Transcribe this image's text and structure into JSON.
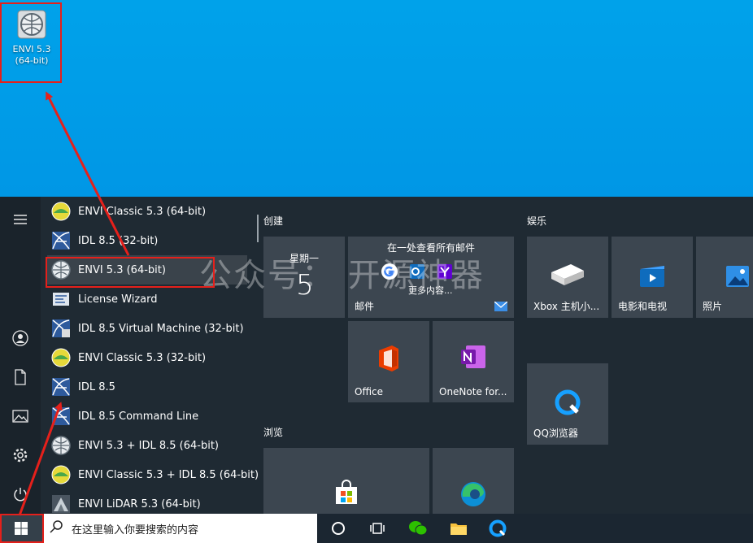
{
  "desktop": {
    "icon_label": "ENVI 5.3\n(64-bit)"
  },
  "apps": [
    {
      "label": "ENVI Classic 5.3 (64-bit)",
      "icon": "envi-classic-icon"
    },
    {
      "label": "IDL 8.5 (32-bit)",
      "icon": "idl-icon"
    },
    {
      "label": "ENVI 5.3 (64-bit)",
      "icon": "envi-icon"
    },
    {
      "label": "License Wizard",
      "icon": "license-wizard-icon"
    },
    {
      "label": "IDL 8.5 Virtual Machine (32-bit)",
      "icon": "idl-vm-icon"
    },
    {
      "label": "ENVI Classic 5.3 (32-bit)",
      "icon": "envi-classic-icon"
    },
    {
      "label": "IDL 8.5",
      "icon": "idl-icon"
    },
    {
      "label": "IDL 8.5 Command Line",
      "icon": "idl-icon"
    },
    {
      "label": "ENVI 5.3 + IDL 8.5 (64-bit)",
      "icon": "envi-icon"
    },
    {
      "label": "ENVI Classic 5.3 + IDL 8.5 (64-bit)",
      "icon": "envi-classic-icon"
    },
    {
      "label": "ENVI LiDAR 5.3 (64-bit)",
      "icon": "envi-lidar-icon"
    }
  ],
  "groups": {
    "create": "创建",
    "entertainment": "娱乐",
    "browse": "浏览"
  },
  "tiles": {
    "calendar_day": "星期一",
    "calendar_date": "5",
    "mail_header": "在一处查看所有邮件",
    "mail_more": "更多内容...",
    "mail_label": "邮件",
    "office_label": "Office",
    "onenote_label": "OneNote for...",
    "xbox_label": "Xbox 主机小...",
    "movies_label": "电影和电视",
    "photos_label": "照片",
    "qq_label": "QQ浏览器"
  },
  "taskbar": {
    "search_placeholder": "在这里输入你要搜索的内容"
  },
  "watermark": "公众号：  开源神器",
  "colors": {
    "highlight": "#e5201b",
    "accent": "#0078d7"
  }
}
